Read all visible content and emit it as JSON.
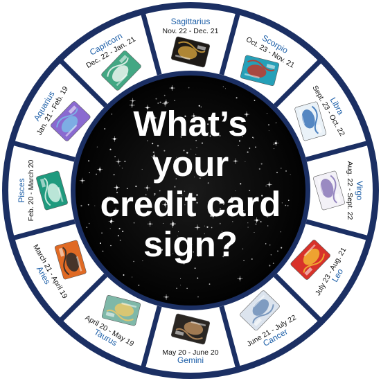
{
  "headline": {
    "lines": [
      "What’s",
      "your",
      "credit card",
      "sign?"
    ]
  },
  "colors": {
    "ring": "#1b2f63",
    "center": "#050505",
    "segment_bg": "#ffffff",
    "sign_name": "#1d5fa8",
    "dates": "#111111",
    "headline": "#ffffff"
  },
  "signs": [
    {
      "name": "Sagittarius",
      "dates": "Nov. 22 - Dec. 21",
      "card_color": "#1e1a16",
      "card_accent": "#c99a3a",
      "icon": "archer-card-icon"
    },
    {
      "name": "Scorpio",
      "dates": "Oct. 23 - Nov. 21",
      "card_color": "#25a0b8",
      "card_accent": "#c0392b",
      "icon": "scorpion-card-icon"
    },
    {
      "name": "Libra",
      "dates": "Sept. 23 - Oct. 22",
      "card_color": "#eaf2f8",
      "card_accent": "#3b74b8",
      "icon": "scales-card-icon"
    },
    {
      "name": "Virgo",
      "dates": "Aug. 22 - Sept. 22",
      "card_color": "#f3f1f7",
      "card_accent": "#8a78b8",
      "icon": "virgo-glyph-card-icon"
    },
    {
      "name": "Leo",
      "dates": "July 23 - Aug. 21",
      "card_color": "#d8322a",
      "card_accent": "#f2b632",
      "icon": "lion-card-icon"
    },
    {
      "name": "Cancer",
      "dates": "June 21 - July 22",
      "card_color": "#dce4ee",
      "card_accent": "#6f8fb8",
      "icon": "crab-card-icon"
    },
    {
      "name": "Gemini",
      "dates": "May 20 - June 20",
      "card_color": "#2a2622",
      "card_accent": "#b58a5a",
      "icon": "twins-card-icon"
    },
    {
      "name": "Taurus",
      "dates": "April 20 - May 19",
      "card_color": "#7fb8a8",
      "card_accent": "#e8c86a",
      "icon": "bull-card-icon"
    },
    {
      "name": "Aries",
      "dates": "March 21 - April 19",
      "card_color": "#e06a24",
      "card_accent": "#2a2a2a",
      "icon": "ram-card-icon"
    },
    {
      "name": "Pisces",
      "dates": "Feb. 20 - March 20",
      "card_color": "#1f9a7e",
      "card_accent": "#d6f2e6",
      "icon": "fish-card-icon"
    },
    {
      "name": "Aquarius",
      "dates": "Jan. 21 - Feb. 19",
      "card_color": "#8a6ad0",
      "card_accent": "#7ab8e8",
      "icon": "water-bearer-card-icon"
    },
    {
      "name": "Capricorn",
      "dates": "Dec. 22 - Jan. 21",
      "card_color": "#43a783",
      "card_accent": "#eaf4ee",
      "icon": "goat-card-icon"
    }
  ]
}
